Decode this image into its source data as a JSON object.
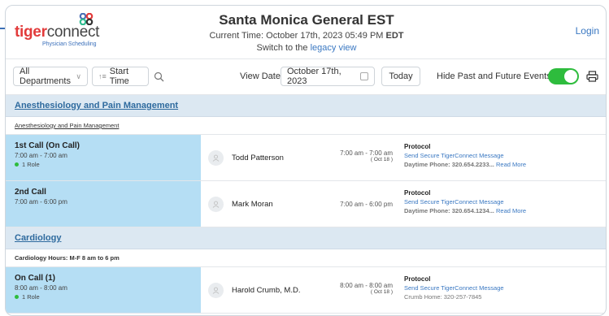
{
  "header": {
    "logo_tiger": "tiger",
    "logo_connect": "connect",
    "logo_sub": "Physician Scheduling",
    "title": "Santa Monica General EST",
    "time_prefix": "Current Time: October 17th, 2023 05:49 PM ",
    "time_zone": "EDT",
    "switch_prefix": "Switch to the ",
    "switch_link": "legacy view",
    "login": "Login"
  },
  "toolbar": {
    "department": "All Departments",
    "start_time": "Start Time",
    "view_date_label": "View Date",
    "view_date_value": "October 17th, 2023",
    "today": "Today",
    "hide_label": "Hide Past and Future Events",
    "toggle_on": true
  },
  "sections": [
    {
      "title": "Anesthesiology and Pain Management",
      "subtitle": "Anesthesiology and Pain Management",
      "rows": [
        {
          "role": "1st Call (On Call)",
          "role_time": "7:00 am - 7:00 am",
          "role_count": "1 Role",
          "person": "Todd Patterson",
          "shift": "7:00 am - 7:00 am",
          "shift_note": "( Oct 18 )",
          "protocol": "Protocol",
          "message": "Send Secure TigerConnect Message",
          "phone": "Daytime Phone: 320.654.2233...",
          "read_more": "Read More"
        },
        {
          "role": "2nd Call",
          "role_time": "7:00 am - 6:00 pm",
          "person": "Mark Moran",
          "shift": "7:00 am - 6:00 pm",
          "protocol": "Protocol",
          "message": "Send Secure TigerConnect Message",
          "phone": "Daytime Phone: 320.654.1234...",
          "read_more": "Read More"
        }
      ]
    },
    {
      "title": "Cardiology",
      "subtitle": "Cardiology Hours:  M-F 8 am to 6 pm",
      "rows": [
        {
          "role": "On Call (1)",
          "role_time": "8:00 am - 8:00 am",
          "role_count": "1 Role",
          "person": "Harold Crumb, M.D.",
          "shift": "8:00 am - 8:00 am",
          "shift_note": "( Oct 18 )",
          "protocol": "Protocol",
          "message": "Send Secure TigerConnect Message",
          "home": "Crumb Home: 320-257-7845"
        }
      ]
    }
  ],
  "colors": {
    "accent": "#3a78c2",
    "toggle": "#2ebc3d",
    "role_bg": "#b5def4",
    "section_bg": "#dce8f2",
    "brand_red": "#e23b3b"
  }
}
